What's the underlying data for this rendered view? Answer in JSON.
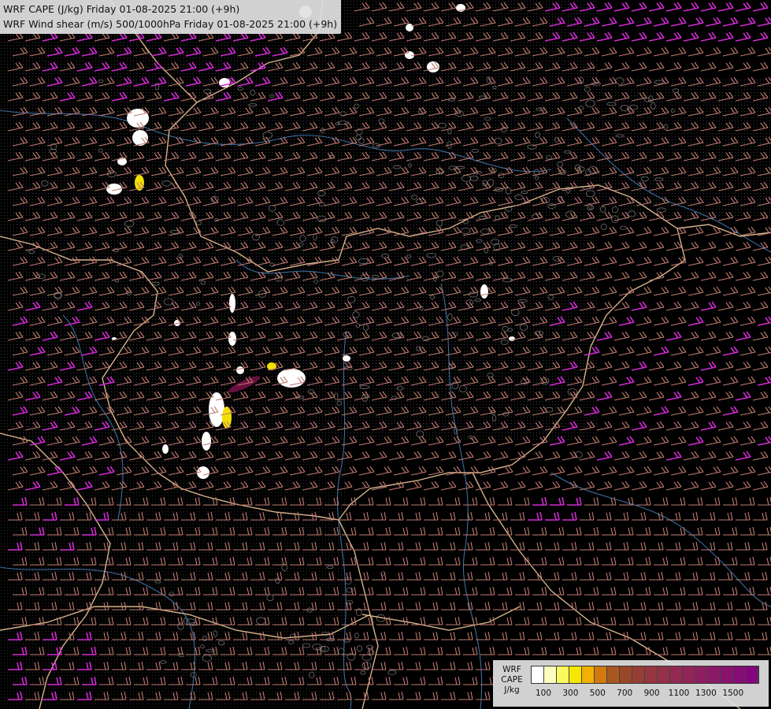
{
  "titles": {
    "line1": "WRF CAPE (J/kg) Friday 01-08-2025 21:00 (+9h)",
    "line2": "WRF Wind shear (m/s) 500/1000hPa Friday 01-08-2025 21:00 (+9h)"
  },
  "legend": {
    "title_lines": [
      "WRF",
      "CAPE",
      "J/kg"
    ],
    "colors": [
      "#ffffff",
      "#fdfdc0",
      "#fafa60",
      "#f7e600",
      "#f2b000",
      "#d27a10",
      "#a85820",
      "#984828",
      "#963e34",
      "#963640",
      "#963049",
      "#932a52",
      "#912459",
      "#8f1e60",
      "#8c1868",
      "#89126f",
      "#860c76",
      "#83067e"
    ],
    "tick_labels": [
      "100",
      "300",
      "500",
      "700",
      "900",
      "1100",
      "1300",
      "1500"
    ]
  },
  "map_colors": {
    "background": "#000000",
    "barb_normal": "#c07b70",
    "barb_strong": "#d22ad2",
    "border": "#d7b48c",
    "river": "#3c6ea0",
    "terrain_contour": "#8a8a8a",
    "cape_low": "#ffffff",
    "cape_mid": "#f2e000",
    "cape_high": "#6a1040"
  }
}
